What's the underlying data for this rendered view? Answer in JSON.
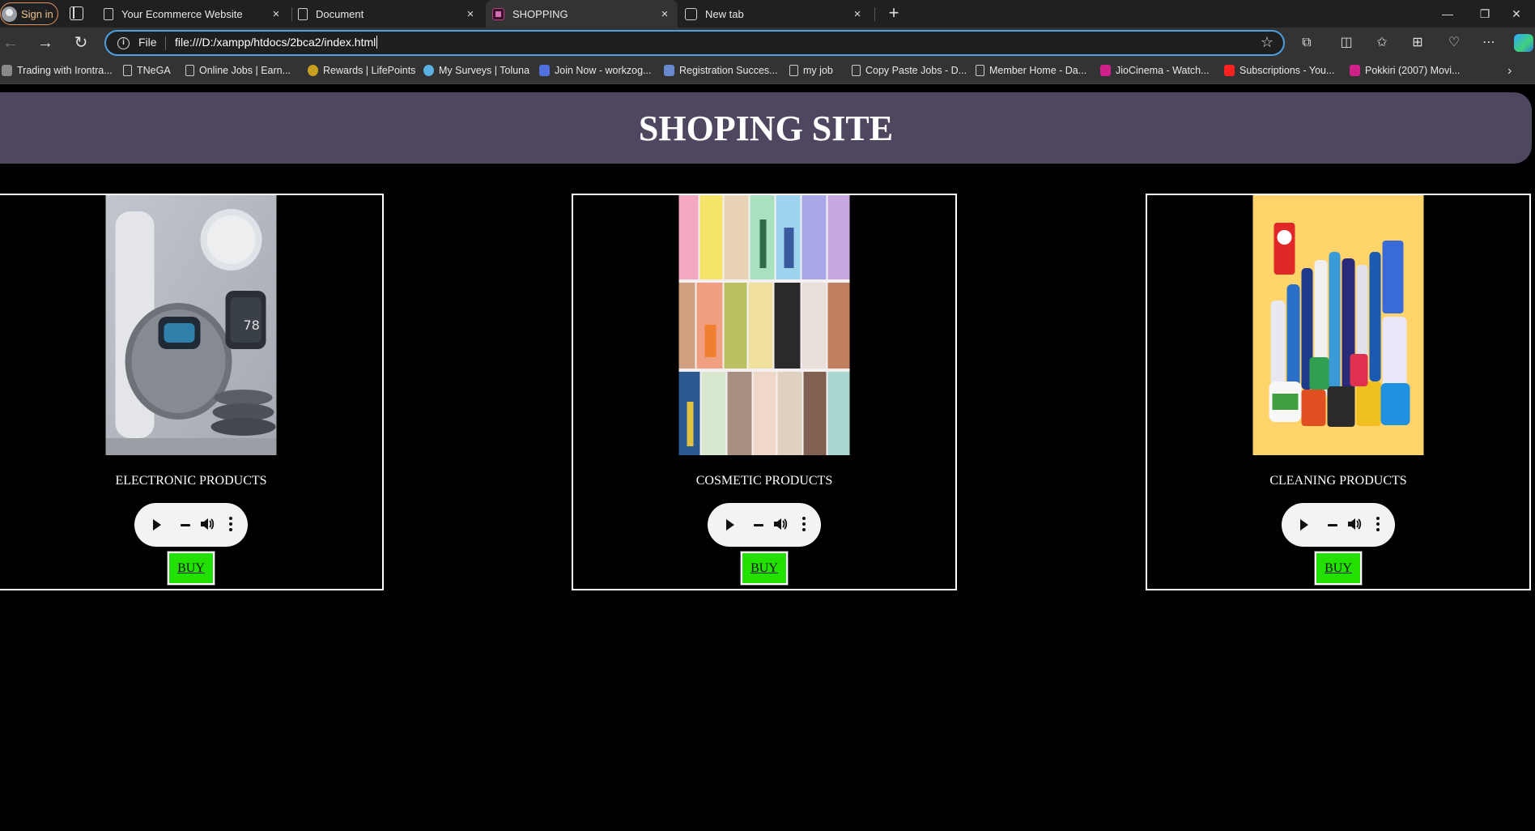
{
  "browser": {
    "sign_in": "Sign in",
    "tabs": [
      {
        "title": "Your Ecommerce Website",
        "icon": "document-icon",
        "active": false
      },
      {
        "title": "Document",
        "icon": "document-icon",
        "active": false
      },
      {
        "title": "SHOPPING",
        "icon": "shop-favicon",
        "active": true
      },
      {
        "title": "New tab",
        "icon": "newtab-icon",
        "active": false
      }
    ],
    "tab_close": "×",
    "new_tab": "+",
    "window_controls": {
      "minimize": "—",
      "restore": "❐",
      "close": "✕"
    },
    "nav": {
      "back": "←",
      "forward": "→",
      "reload": "↻"
    },
    "address": {
      "scheme": "File",
      "url": "file:///D:/xampp/htdocs/2bca2/index.html",
      "info": "i",
      "favorite": "☆"
    },
    "toolbar_icons": {
      "extensions": "⧉",
      "split": "◫",
      "favorites": "✩",
      "collections": "⊞",
      "health": "♡",
      "menu": "⋯"
    },
    "bookmarks": [
      {
        "label": "Trading with Irontra...",
        "icon": "trading-icon",
        "color": "#8a8a8a"
      },
      {
        "label": "TNeGA",
        "icon": "page-icon",
        "color": ""
      },
      {
        "label": "Online Jobs | Earn...",
        "icon": "page-icon",
        "color": ""
      },
      {
        "label": "Rewards | LifePoints",
        "icon": "lifepoints-icon",
        "color": "#c8a020"
      },
      {
        "label": "My Surveys | Toluna",
        "icon": "toluna-icon",
        "color": "#5ab0e0"
      },
      {
        "label": "Join Now - workzog...",
        "icon": "workzog-icon",
        "color": "#5070e0"
      },
      {
        "label": "Registration Succes...",
        "icon": "registration-icon",
        "color": "#6a8ad0"
      },
      {
        "label": "my job",
        "icon": "page-icon",
        "color": ""
      },
      {
        "label": "Copy Paste Jobs - D...",
        "icon": "page-icon",
        "color": ""
      },
      {
        "label": "Member Home - Da...",
        "icon": "page-icon",
        "color": ""
      },
      {
        "label": "JioCinema - Watch...",
        "icon": "jiocinema-icon",
        "color": "#d0208a"
      },
      {
        "label": "Subscriptions - You...",
        "icon": "youtube-icon",
        "color": "#ff2020"
      },
      {
        "label": "Pokkiri (2007) Movi...",
        "icon": "jiocinema-icon",
        "color": "#d0208a"
      }
    ],
    "bookmarks_more": "›"
  },
  "page": {
    "title": "SHOPING SITE",
    "header_color": "#4f4660",
    "products": [
      {
        "label": "ELECTRONIC PRODUCTS",
        "image": "electronics-image",
        "buy": "BUY"
      },
      {
        "label": "COSMETIC PRODUCTS",
        "image": "cosmetics-image",
        "buy": "BUY"
      },
      {
        "label": "CLEANING PRODUCTS",
        "image": "cleaning-image",
        "buy": "BUY"
      }
    ],
    "buy_color": "#22e000"
  }
}
